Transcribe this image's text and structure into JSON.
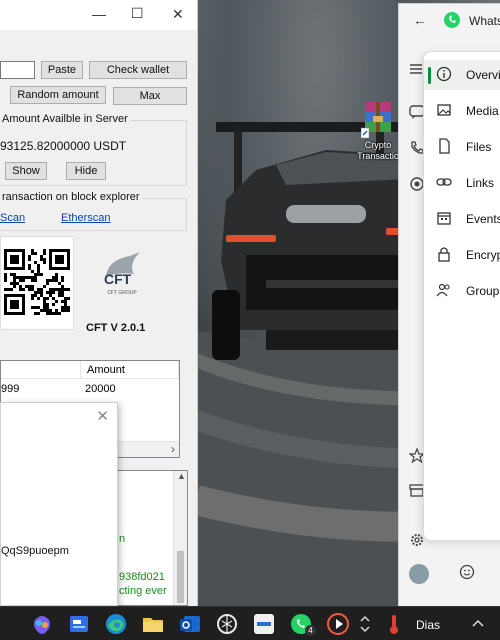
{
  "wallet": {
    "paste_label": "Paste",
    "check_wallet_label": "Check wallet",
    "random_amount_label": "Random amount",
    "max_label": "Max",
    "server_group_title": "Amount Availble in Server",
    "server_amount": "93125.82000000 USDT",
    "show_label": "Show",
    "hide_label": "Hide",
    "explorer_group_title": "ransaction on block explorer",
    "explorer_link_1": "Scan",
    "explorer_link_2": "Etherscan",
    "logo_text": "CFT GROUP",
    "version": "CFT V 2.0.1",
    "grid": {
      "columns": [
        "",
        "Amount"
      ],
      "rows": [
        [
          "999",
          "20000"
        ]
      ]
    },
    "log_lines": [
      "n",
      "938fd021",
      "cting ever"
    ]
  },
  "popup": {
    "address_fragment": "QqS9puoepm"
  },
  "desktop_icon": {
    "label_line1": "Crypto",
    "label_line2": "Transactio"
  },
  "whatsapp": {
    "title": "WhatsA",
    "menu": [
      {
        "label": "Overvi",
        "icon": "info-icon",
        "active": true
      },
      {
        "label": "Media",
        "icon": "media-icon",
        "active": false
      },
      {
        "label": "Files",
        "icon": "file-icon",
        "active": false
      },
      {
        "label": "Links",
        "icon": "link-icon",
        "active": false
      },
      {
        "label": "Events",
        "icon": "calendar-icon",
        "active": false
      },
      {
        "label": "Encryp",
        "icon": "lock-icon",
        "active": false
      },
      {
        "label": "Groups",
        "icon": "group-icon",
        "active": false
      }
    ],
    "accent_color": "#0c8a3e"
  },
  "taskbar": {
    "whatsapp_badge": "4",
    "tray_label": "Dias"
  }
}
